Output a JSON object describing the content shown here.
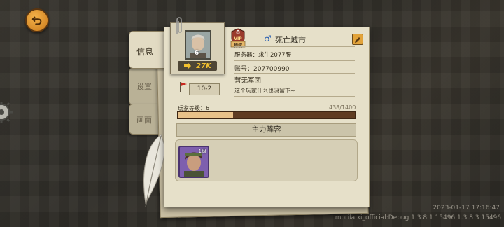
{
  "tabs": [
    {
      "label": "信息"
    },
    {
      "label": "设置"
    },
    {
      "label": "画面"
    }
  ],
  "profile": {
    "portrait_level": "6",
    "power": "27K",
    "vip_level": "0",
    "vip_label": "VIP",
    "vip_sub": "特权",
    "gender_icon": "male-icon",
    "name": "死亡城市",
    "server": "服务器：求生2077服",
    "account": "账号：207700990",
    "legion": "暂无军团",
    "signature": "这个玩家什么也没留下~",
    "stage": "10-2"
  },
  "level": {
    "label": "玩家等级：6",
    "xp_text": "438/1400",
    "xp_fraction": 0.313
  },
  "lineup": {
    "title": "主力阵容",
    "heroes": [
      {
        "level": "1级"
      }
    ]
  },
  "footer": {
    "datetime": "2023-01-17 17:16:47",
    "build": "morilaixi_official:Debug 1.3.8 1 15496 1.3.8 3 15496"
  },
  "colors": {
    "panel_bg": "#e6e0c9",
    "power_text": "#f3c12e",
    "xp_fill": "#e8c189",
    "xp_track": "#5f3c22",
    "back_button": "#e89a2c"
  }
}
